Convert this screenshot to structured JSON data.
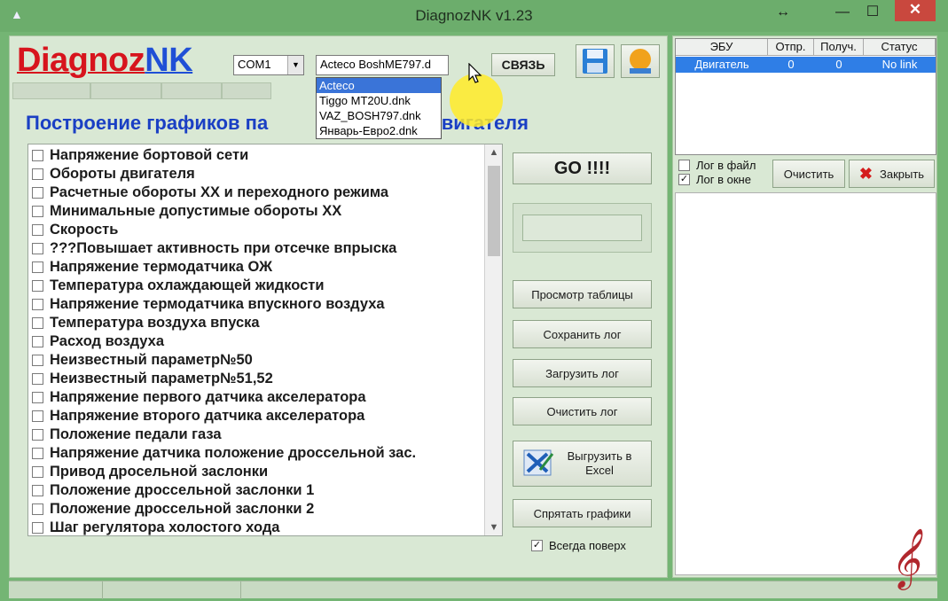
{
  "window": {
    "title": "DiagnozNK v1.23",
    "close": "✕",
    "minimize": "—",
    "maximize": "☐",
    "restore": "↔"
  },
  "logo": {
    "part1": "Diagnoz",
    "part2": "NK"
  },
  "toolbar": {
    "port_value": "COM1",
    "profile_value": "Acteco BoshME797.d",
    "connect_label": "СВЯЗЬ"
  },
  "profile_options": [
    {
      "label": "Acteco BoshME797.dnk",
      "selected": true
    },
    {
      "label": "Tiggo MT20U.dnk",
      "selected": false
    },
    {
      "label": "VAZ_BOSH797.dnk",
      "selected": false
    },
    {
      "label": "Январь-Евро2.dnk",
      "selected": false
    }
  ],
  "heading": "Построение графиков па",
  "heading_tail": "оты двигателя",
  "params": [
    "Напряжение бортовой сети",
    "Обороты двигателя",
    "Расчетные обороты ХХ и переходного режима",
    "Минимальные допустимые обороты ХХ",
    "Скорость",
    "???Повышает активность при отсечке впрыска",
    "Напряжение термодатчика ОЖ",
    "Температура охлаждающей жидкости",
    "Напряжение термодатчика впускного воздуха",
    "Температура воздуха впуска",
    "Расход воздуха",
    "Неизвестный параметр№50",
    "Неизвестный параметр№51,52",
    "Напряжение первого датчика акселератора",
    "Напряжение второго датчика акселератора",
    "Положение педали газа",
    "Напряжение датчика положение дроссельной зас.",
    "Привод дросельной заслонки",
    "Положение дроссельной заслонки 1",
    "Положение дроссельной заслонки 2",
    "Шаг регулятора холостого хода"
  ],
  "buttons": {
    "go": "GO !!!!",
    "view_table": "Просмотр таблицы",
    "save_log": "Сохранить лог",
    "load_log": "Загрузить лог",
    "clear_log": "Очистить лог",
    "export_excel": "Выгрузить в Excel",
    "hide_graphs": "Спрятать графики",
    "always_on_top": "Всегда поверх",
    "clear": "Очистить",
    "close": "Закрыть"
  },
  "ecu_table": {
    "headers": [
      "ЭБУ",
      "Отпр.",
      "Получ.",
      "Статус"
    ],
    "rows": [
      [
        "Двигатель",
        "0",
        "0",
        "No link"
      ]
    ]
  },
  "log_options": {
    "to_file": "Лог в файл",
    "to_window": "Лог в окне"
  },
  "colors": {
    "accent": "#1a3fc4",
    "logo_red": "#d7141d",
    "selection": "#2f7ee6"
  }
}
